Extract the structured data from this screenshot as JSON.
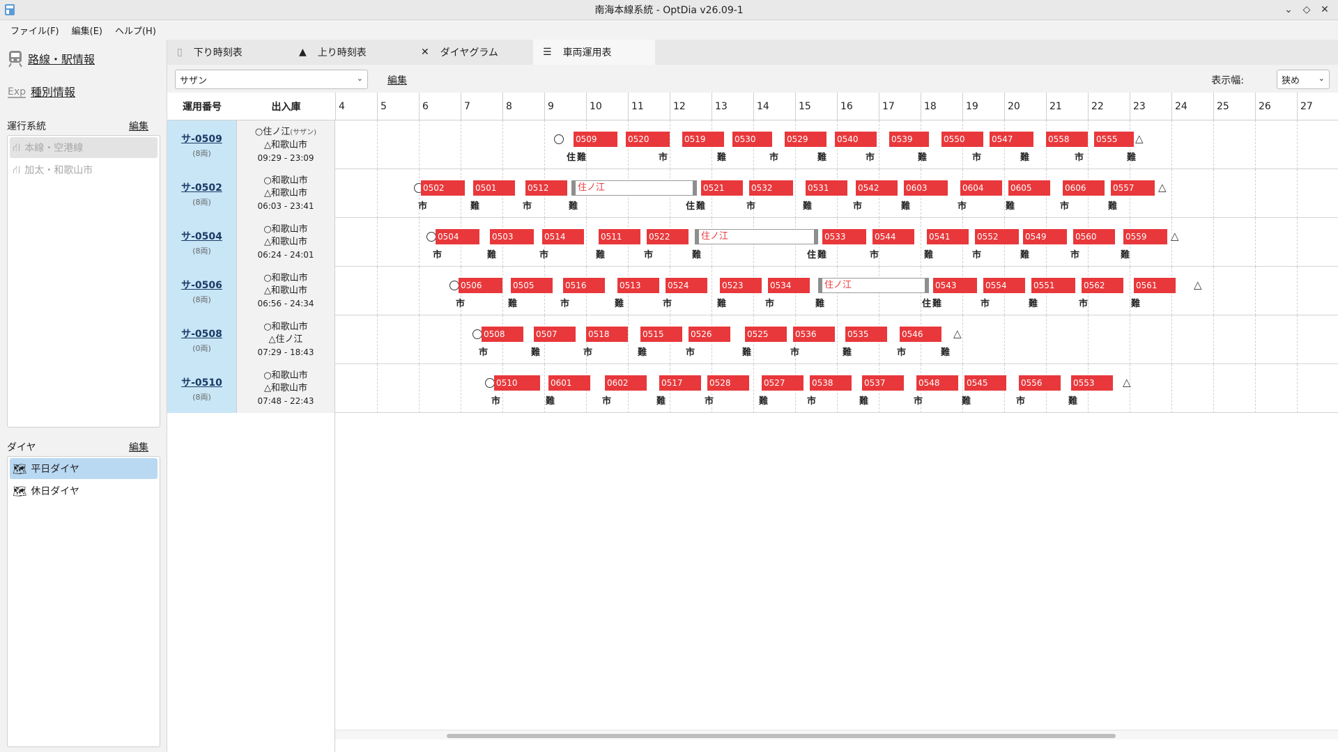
{
  "window": {
    "title": "南海本線系統 - OptDia v26.09-1"
  },
  "menu": [
    "ファイル(F)",
    "編集(E)",
    "ヘルプ(H)"
  ],
  "sidebar": {
    "route_info": "路線・駅情報",
    "type_info": "種別情報",
    "systems_title": "運行系統",
    "systems_edit": "編集",
    "systems": [
      "本線・空港線",
      "加太・和歌山市"
    ],
    "dia_title": "ダイヤ",
    "dia_edit": "編集",
    "dias": [
      "平日ダイヤ",
      "休日ダイヤ"
    ]
  },
  "tabs": [
    "下り時刻表",
    "上り時刻表",
    "ダイヤグラム",
    "車両運用表"
  ],
  "toolbar": {
    "route_select": "サザン",
    "edit": "編集",
    "width_label": "表示幅:",
    "width_value": "狭め"
  },
  "grid": {
    "col_op": "運用番号",
    "col_depot": "出入庫",
    "hours": [
      "4",
      "5",
      "6",
      "7",
      "8",
      "9",
      "10",
      "11",
      "12",
      "13",
      "14",
      "15",
      "16",
      "17",
      "18",
      "19",
      "20",
      "21",
      "22",
      "23",
      "24",
      "25",
      "26",
      "27"
    ]
  },
  "operations": [
    {
      "id": "サ-0509",
      "cars": "(8両)",
      "depot_out": "○住ノ江",
      "depot_out_sub": "(サザン)",
      "depot_in": "△和歌山市",
      "time": "09:29 - 23:09",
      "start": 9.35,
      "end": 23.1,
      "trains": [
        {
          "no": "0509",
          "s": 9.7,
          "e": 10.75
        },
        {
          "no": "0520",
          "s": 10.95,
          "e": 12.0
        },
        {
          "no": "0519",
          "s": 12.3,
          "e": 13.3
        },
        {
          "no": "0530",
          "s": 13.5,
          "e": 14.45
        },
        {
          "no": "0529",
          "s": 14.75,
          "e": 15.75
        },
        {
          "no": "0540",
          "s": 15.95,
          "e": 16.95
        },
        {
          "no": "0539",
          "s": 17.25,
          "e": 18.2
        },
        {
          "no": "0550",
          "s": 18.5,
          "e": 19.5
        },
        {
          "no": "0547",
          "s": 19.65,
          "e": 20.7
        },
        {
          "no": "0558",
          "s": 21.0,
          "e": 22.0
        },
        {
          "no": "0555",
          "s": 22.15,
          "e": 23.1
        }
      ],
      "stations": [
        {
          "t": 9.6,
          "n": "住"
        },
        {
          "t": 9.85,
          "n": "難"
        },
        {
          "t": 11.8,
          "n": "市"
        },
        {
          "t": 13.2,
          "n": "難"
        },
        {
          "t": 14.45,
          "n": "市"
        },
        {
          "t": 15.6,
          "n": "難"
        },
        {
          "t": 16.75,
          "n": "市"
        },
        {
          "t": 18.0,
          "n": "難"
        },
        {
          "t": 19.3,
          "n": "市"
        },
        {
          "t": 20.45,
          "n": "難"
        },
        {
          "t": 21.75,
          "n": "市"
        },
        {
          "t": 23.0,
          "n": "難"
        }
      ]
    },
    {
      "id": "サ-0502",
      "cars": "(8両)",
      "depot_out": "○和歌山市",
      "depot_out_sub": "",
      "depot_in": "△和歌山市",
      "time": "06:03 - 23:41",
      "start": 6.0,
      "end": 23.65,
      "trains": [
        {
          "no": "0502",
          "s": 6.05,
          "e": 7.1
        },
        {
          "no": "0501",
          "s": 7.3,
          "e": 8.3
        },
        {
          "no": "0512",
          "s": 8.55,
          "e": 9.55
        },
        {
          "no": "0521",
          "s": 12.75,
          "e": 13.75
        },
        {
          "no": "0532",
          "s": 13.9,
          "e": 14.95
        },
        {
          "no": "0531",
          "s": 15.25,
          "e": 16.25
        },
        {
          "no": "0542",
          "s": 16.45,
          "e": 17.45
        },
        {
          "no": "0603",
          "s": 17.6,
          "e": 18.65
        },
        {
          "no": "0604",
          "s": 18.95,
          "e": 19.95
        },
        {
          "no": "0605",
          "s": 20.1,
          "e": 21.1
        },
        {
          "no": "0606",
          "s": 21.4,
          "e": 22.4
        },
        {
          "no": "0557",
          "s": 22.55,
          "e": 23.6
        }
      ],
      "layover": {
        "label": "住ノ江",
        "s": 9.65,
        "e": 12.65
      },
      "stations": [
        {
          "t": 6.05,
          "n": "市"
        },
        {
          "t": 7.3,
          "n": "難"
        },
        {
          "t": 8.55,
          "n": "市"
        },
        {
          "t": 9.65,
          "n": "難"
        },
        {
          "t": 12.45,
          "n": "住"
        },
        {
          "t": 12.7,
          "n": "難"
        },
        {
          "t": 13.9,
          "n": "市"
        },
        {
          "t": 15.25,
          "n": "難"
        },
        {
          "t": 16.45,
          "n": "市"
        },
        {
          "t": 17.6,
          "n": "難"
        },
        {
          "t": 18.95,
          "n": "市"
        },
        {
          "t": 20.1,
          "n": "難"
        },
        {
          "t": 21.4,
          "n": "市"
        },
        {
          "t": 22.55,
          "n": "難"
        }
      ]
    },
    {
      "id": "サ-0504",
      "cars": "(8両)",
      "depot_out": "○和歌山市",
      "depot_out_sub": "",
      "depot_in": "△和歌山市",
      "time": "06:24 - 24:01",
      "start": 6.3,
      "end": 23.95,
      "trains": [
        {
          "no": "0504",
          "s": 6.4,
          "e": 7.45
        },
        {
          "no": "0503",
          "s": 7.7,
          "e": 8.75
        },
        {
          "no": "0514",
          "s": 8.95,
          "e": 9.95
        },
        {
          "no": "0511",
          "s": 10.3,
          "e": 11.3
        },
        {
          "no": "0522",
          "s": 11.45,
          "e": 12.45
        },
        {
          "no": "0533",
          "s": 15.65,
          "e": 16.7
        },
        {
          "no": "0544",
          "s": 16.85,
          "e": 17.85
        },
        {
          "no": "0541",
          "s": 18.15,
          "e": 19.15
        },
        {
          "no": "0552",
          "s": 19.3,
          "e": 20.35
        },
        {
          "no": "0549",
          "s": 20.45,
          "e": 21.5
        },
        {
          "no": "0560",
          "s": 21.65,
          "e": 22.65
        },
        {
          "no": "0559",
          "s": 22.85,
          "e": 23.9
        }
      ],
      "layover": {
        "label": "住ノ江",
        "s": 12.6,
        "e": 15.55
      },
      "stations": [
        {
          "t": 6.4,
          "n": "市"
        },
        {
          "t": 7.7,
          "n": "難"
        },
        {
          "t": 8.95,
          "n": "市"
        },
        {
          "t": 10.3,
          "n": "難"
        },
        {
          "t": 11.45,
          "n": "市"
        },
        {
          "t": 12.6,
          "n": "難"
        },
        {
          "t": 15.35,
          "n": "住"
        },
        {
          "t": 15.6,
          "n": "難"
        },
        {
          "t": 16.85,
          "n": "市"
        },
        {
          "t": 18.15,
          "n": "難"
        },
        {
          "t": 19.3,
          "n": "市"
        },
        {
          "t": 20.45,
          "n": "難"
        },
        {
          "t": 21.65,
          "n": "市"
        },
        {
          "t": 22.85,
          "n": "難"
        }
      ]
    },
    {
      "id": "サ-0506",
      "cars": "(8両)",
      "depot_out": "○和歌山市",
      "depot_out_sub": "",
      "depot_in": "△和歌山市",
      "time": "06:56 - 24:34",
      "start": 6.85,
      "end": 24.5,
      "trains": [
        {
          "no": "0506",
          "s": 6.95,
          "e": 8.0
        },
        {
          "no": "0505",
          "s": 8.2,
          "e": 9.2
        },
        {
          "no": "0516",
          "s": 9.45,
          "e": 10.45
        },
        {
          "no": "0513",
          "s": 10.75,
          "e": 11.75
        },
        {
          "no": "0524",
          "s": 11.9,
          "e": 12.9
        },
        {
          "no": "0523",
          "s": 13.2,
          "e": 14.2
        },
        {
          "no": "0534",
          "s": 14.35,
          "e": 15.35
        },
        {
          "no": "0543",
          "s": 18.3,
          "e": 19.35
        },
        {
          "no": "0554",
          "s": 19.5,
          "e": 20.5
        },
        {
          "no": "0551",
          "s": 20.65,
          "e": 21.7
        },
        {
          "no": "0562",
          "s": 21.85,
          "e": 22.85
        },
        {
          "no": "0561",
          "s": 23.1,
          "e": 24.1
        }
      ],
      "layover": {
        "label": "住ノ江",
        "s": 15.55,
        "e": 18.2
      },
      "stations": [
        {
          "t": 6.95,
          "n": "市"
        },
        {
          "t": 8.2,
          "n": "難"
        },
        {
          "t": 9.45,
          "n": "市"
        },
        {
          "t": 10.75,
          "n": "難"
        },
        {
          "t": 11.9,
          "n": "市"
        },
        {
          "t": 13.2,
          "n": "難"
        },
        {
          "t": 14.35,
          "n": "市"
        },
        {
          "t": 15.55,
          "n": "難"
        },
        {
          "t": 18.1,
          "n": "住"
        },
        {
          "t": 18.35,
          "n": "難"
        },
        {
          "t": 19.5,
          "n": "市"
        },
        {
          "t": 20.65,
          "n": "難"
        },
        {
          "t": 21.85,
          "n": "市"
        },
        {
          "t": 23.1,
          "n": "難"
        }
      ]
    },
    {
      "id": "サ-0508",
      "cars": "(0両)",
      "depot_out": "○和歌山市",
      "depot_out_sub": "",
      "depot_in": "△住ノ江",
      "time": "07:29 - 18:43",
      "start": 7.4,
      "end": 18.75,
      "trains": [
        {
          "no": "0508",
          "s": 7.5,
          "e": 8.5
        },
        {
          "no": "0507",
          "s": 8.75,
          "e": 9.75
        },
        {
          "no": "0518",
          "s": 10.0,
          "e": 11.0
        },
        {
          "no": "0515",
          "s": 11.3,
          "e": 12.3
        },
        {
          "no": "0526",
          "s": 12.45,
          "e": 13.45
        },
        {
          "no": "0525",
          "s": 13.8,
          "e": 14.8
        },
        {
          "no": "0536",
          "s": 14.95,
          "e": 15.95
        },
        {
          "no": "0535",
          "s": 16.2,
          "e": 17.2
        },
        {
          "no": "0546",
          "s": 17.5,
          "e": 18.5
        }
      ],
      "stations": [
        {
          "t": 7.5,
          "n": "市"
        },
        {
          "t": 8.75,
          "n": "難"
        },
        {
          "t": 10.0,
          "n": "市"
        },
        {
          "t": 11.3,
          "n": "難"
        },
        {
          "t": 12.45,
          "n": "市"
        },
        {
          "t": 13.8,
          "n": "難"
        },
        {
          "t": 14.95,
          "n": "市"
        },
        {
          "t": 16.2,
          "n": "難"
        },
        {
          "t": 17.5,
          "n": "市"
        },
        {
          "t": 18.55,
          "n": "難"
        }
      ]
    },
    {
      "id": "サ-0510",
      "cars": "(8両)",
      "depot_out": "○和歌山市",
      "depot_out_sub": "",
      "depot_in": "△和歌山市",
      "time": "07:48 - 22:43",
      "start": 7.7,
      "end": 22.8,
      "trains": [
        {
          "no": "0510",
          "s": 7.8,
          "e": 8.9
        },
        {
          "no": "0601",
          "s": 9.1,
          "e": 10.1
        },
        {
          "no": "0602",
          "s": 10.45,
          "e": 11.45
        },
        {
          "no": "0517",
          "s": 11.75,
          "e": 12.75
        },
        {
          "no": "0528",
          "s": 12.9,
          "e": 13.9
        },
        {
          "no": "0527",
          "s": 14.2,
          "e": 15.2
        },
        {
          "no": "0538",
          "s": 15.35,
          "e": 16.35
        },
        {
          "no": "0537",
          "s": 16.6,
          "e": 17.6
        },
        {
          "no": "0548",
          "s": 17.9,
          "e": 18.9
        },
        {
          "no": "0545",
          "s": 19.05,
          "e": 20.05
        },
        {
          "no": "0556",
          "s": 20.35,
          "e": 21.35
        },
        {
          "no": "0553",
          "s": 21.6,
          "e": 22.6
        }
      ],
      "stations": [
        {
          "t": 7.8,
          "n": "市"
        },
        {
          "t": 9.1,
          "n": "難"
        },
        {
          "t": 10.45,
          "n": "市"
        },
        {
          "t": 11.75,
          "n": "難"
        },
        {
          "t": 12.9,
          "n": "市"
        },
        {
          "t": 14.2,
          "n": "難"
        },
        {
          "t": 15.35,
          "n": "市"
        },
        {
          "t": 16.6,
          "n": "難"
        },
        {
          "t": 17.9,
          "n": "市"
        },
        {
          "t": 19.05,
          "n": "難"
        },
        {
          "t": 20.35,
          "n": "市"
        },
        {
          "t": 21.6,
          "n": "難"
        }
      ]
    }
  ]
}
